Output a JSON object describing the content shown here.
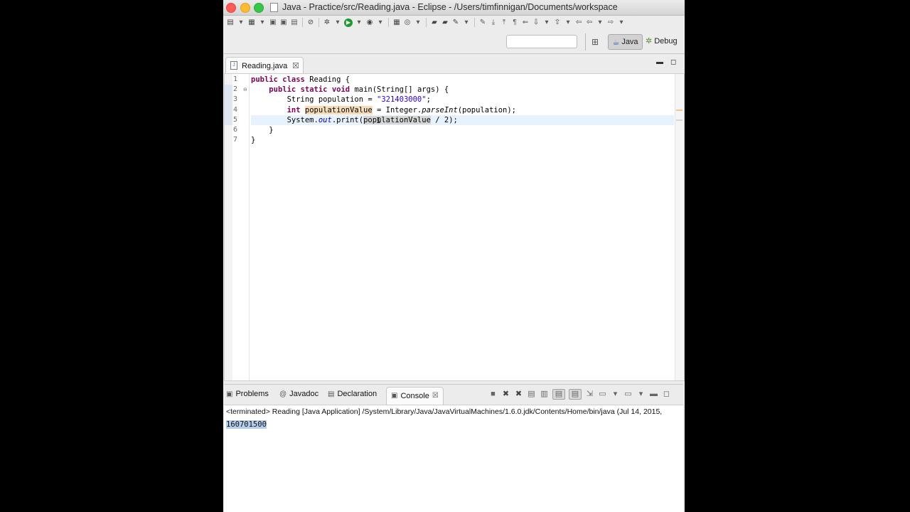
{
  "window": {
    "title": "Java - Practice/src/Reading.java - Eclipse - /Users/timfinnigan/Documents/workspace"
  },
  "perspectives": {
    "java_label": "Java",
    "debug_label": "Debug"
  },
  "editor": {
    "tab_label": "Reading.java",
    "line_numbers": [
      "1",
      "2",
      "3",
      "4",
      "5",
      "6",
      "7"
    ],
    "code": {
      "l1_kw1": "public",
      "l1_kw2": "class",
      "l1_rest": " Reading {",
      "l2_kw1": "public",
      "l2_kw2": "static",
      "l2_kw3": "void",
      "l2_rest": " main(String[] args) {",
      "l3_a": "String population = ",
      "l3_str": "\"321403000\"",
      "l3_b": ";",
      "l4_kw": "int",
      "l4_var": "populationValue",
      "l4_a": " = Integer.",
      "l4_method": "parseInt",
      "l4_b": "(population);",
      "l5_a": "System.",
      "l5_field": "out",
      "l5_b": ".print(",
      "l5_var": "populationValue",
      "l5_c": " / 2);",
      "l6": "}",
      "l7": "}"
    }
  },
  "panel": {
    "tabs": {
      "problems": "Problems",
      "javadoc": "Javadoc",
      "declaration": "Declaration",
      "console": "Console"
    },
    "console": {
      "header": "<terminated> Reading [Java Application] /System/Library/Java/JavaVirtualMachines/1.6.0.jdk/Contents/Home/bin/java (Jul 14, 2015,",
      "output": "160701500"
    }
  }
}
